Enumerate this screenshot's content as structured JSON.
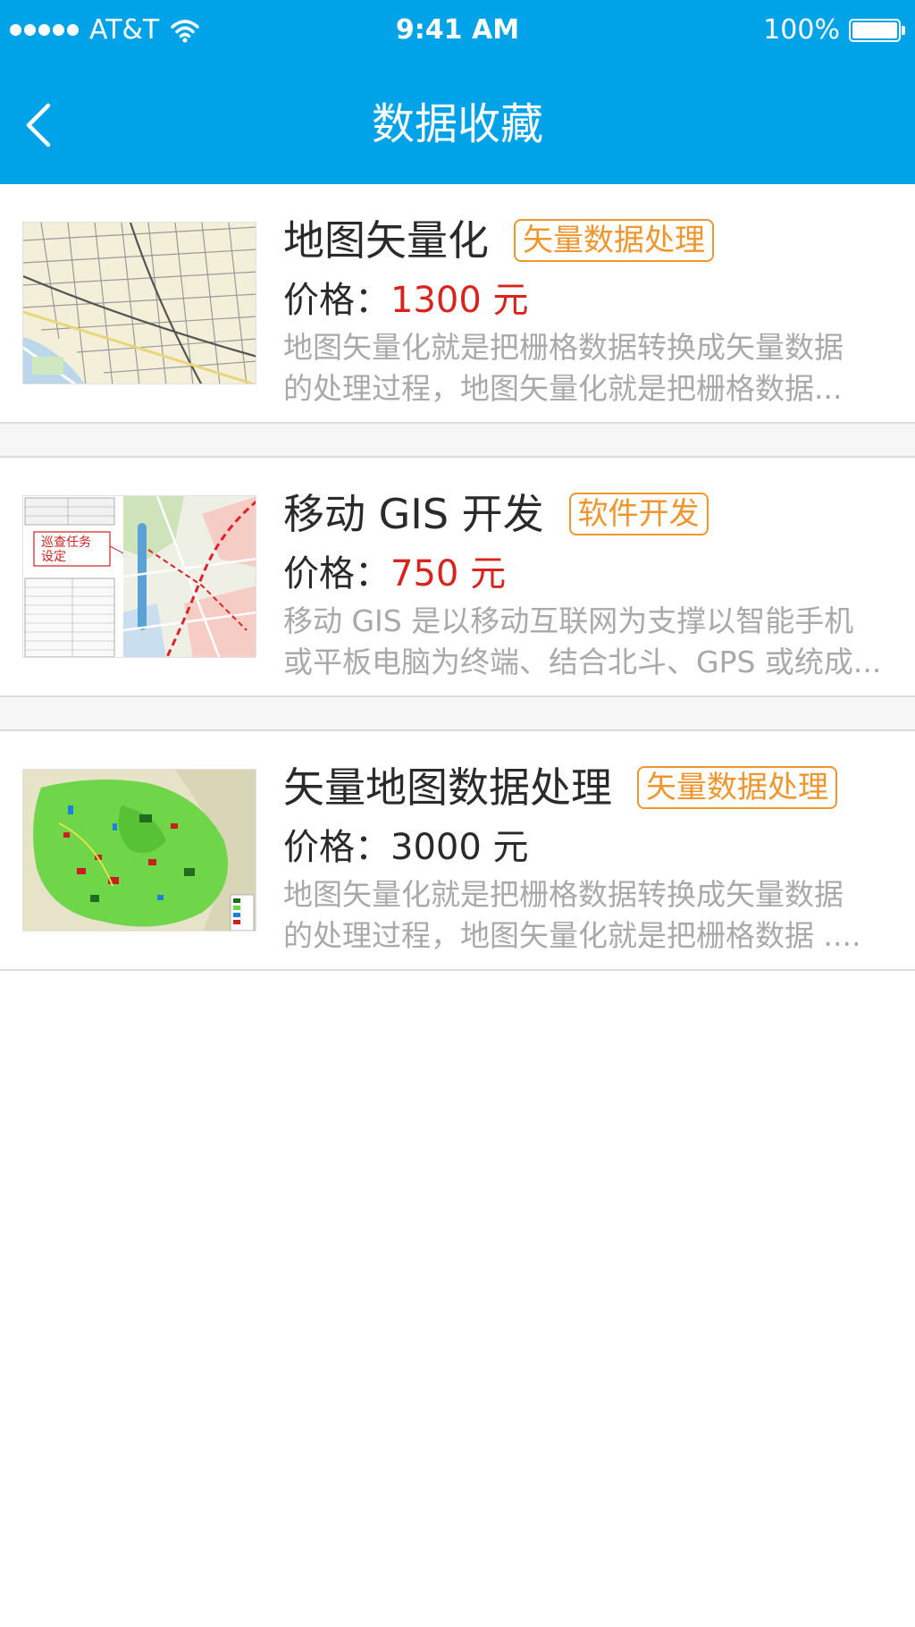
{
  "status_bar": {
    "carrier": "AT&T",
    "time": "9:41 AM",
    "battery": "100%"
  },
  "nav": {
    "title": "数据收藏",
    "back_icon": "chevron-left-icon"
  },
  "colors": {
    "header": "#00a3e8",
    "tag": "#f0962e",
    "price_highlight": "#d7241d",
    "description": "#a9a9a9"
  },
  "items": [
    {
      "title": "地图矢量化",
      "tag": "矢量数据处理",
      "price_label": "价格：",
      "price": "1300 元",
      "price_highlighted": true,
      "desc_line1": "地图矢量化就是把栅格数据转换成矢量数据",
      "desc_line2": "的处理过程，地图矢量化就是把栅格数据...",
      "thumbnail": "street-map-thumbnail"
    },
    {
      "title": "移动 GIS 开发",
      "tag": "软件开发",
      "price_label": "价格：",
      "price": "750 元",
      "price_highlighted": true,
      "desc_line1": "移动 GIS 是以移动互联网为支撑以智能手机",
      "desc_line2": "或平板电脑为终端、结合北斗、GPS 或统成...",
      "thumbnail": "patrol-task-map-thumbnail",
      "thumbnail_caption": "巡查任务设定"
    },
    {
      "title": "矢量地图数据处理",
      "tag": "矢量数据处理",
      "price_label": "价格：",
      "price": "3000 元",
      "price_highlighted": false,
      "desc_line1": "地图矢量化就是把栅格数据转换成矢量数据",
      "desc_line2": "的处理过程，地图矢量化就是把栅格数据 ....",
      "thumbnail": "land-use-map-thumbnail"
    }
  ]
}
